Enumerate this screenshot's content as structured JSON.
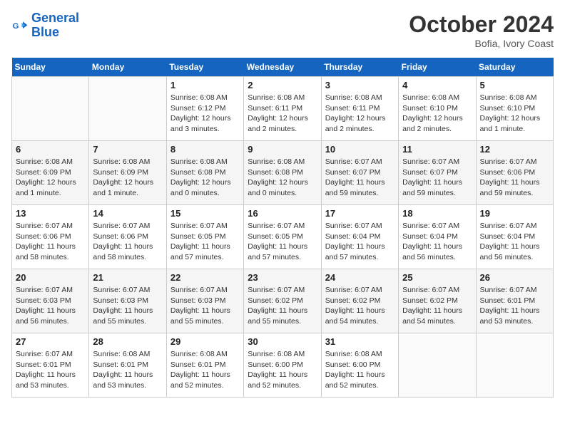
{
  "logo": {
    "line1": "General",
    "line2": "Blue"
  },
  "title": "October 2024",
  "subtitle": "Bofia, Ivory Coast",
  "header": {
    "days": [
      "Sunday",
      "Monday",
      "Tuesday",
      "Wednesday",
      "Thursday",
      "Friday",
      "Saturday"
    ]
  },
  "weeks": [
    [
      {
        "day": "",
        "info": ""
      },
      {
        "day": "",
        "info": ""
      },
      {
        "day": "1",
        "info": "Sunrise: 6:08 AM\nSunset: 6:12 PM\nDaylight: 12 hours and 3 minutes."
      },
      {
        "day": "2",
        "info": "Sunrise: 6:08 AM\nSunset: 6:11 PM\nDaylight: 12 hours and 2 minutes."
      },
      {
        "day": "3",
        "info": "Sunrise: 6:08 AM\nSunset: 6:11 PM\nDaylight: 12 hours and 2 minutes."
      },
      {
        "day": "4",
        "info": "Sunrise: 6:08 AM\nSunset: 6:10 PM\nDaylight: 12 hours and 2 minutes."
      },
      {
        "day": "5",
        "info": "Sunrise: 6:08 AM\nSunset: 6:10 PM\nDaylight: 12 hours and 1 minute."
      }
    ],
    [
      {
        "day": "6",
        "info": "Sunrise: 6:08 AM\nSunset: 6:09 PM\nDaylight: 12 hours and 1 minute."
      },
      {
        "day": "7",
        "info": "Sunrise: 6:08 AM\nSunset: 6:09 PM\nDaylight: 12 hours and 1 minute."
      },
      {
        "day": "8",
        "info": "Sunrise: 6:08 AM\nSunset: 6:08 PM\nDaylight: 12 hours and 0 minutes."
      },
      {
        "day": "9",
        "info": "Sunrise: 6:08 AM\nSunset: 6:08 PM\nDaylight: 12 hours and 0 minutes."
      },
      {
        "day": "10",
        "info": "Sunrise: 6:07 AM\nSunset: 6:07 PM\nDaylight: 11 hours and 59 minutes."
      },
      {
        "day": "11",
        "info": "Sunrise: 6:07 AM\nSunset: 6:07 PM\nDaylight: 11 hours and 59 minutes."
      },
      {
        "day": "12",
        "info": "Sunrise: 6:07 AM\nSunset: 6:06 PM\nDaylight: 11 hours and 59 minutes."
      }
    ],
    [
      {
        "day": "13",
        "info": "Sunrise: 6:07 AM\nSunset: 6:06 PM\nDaylight: 11 hours and 58 minutes."
      },
      {
        "day": "14",
        "info": "Sunrise: 6:07 AM\nSunset: 6:06 PM\nDaylight: 11 hours and 58 minutes."
      },
      {
        "day": "15",
        "info": "Sunrise: 6:07 AM\nSunset: 6:05 PM\nDaylight: 11 hours and 57 minutes."
      },
      {
        "day": "16",
        "info": "Sunrise: 6:07 AM\nSunset: 6:05 PM\nDaylight: 11 hours and 57 minutes."
      },
      {
        "day": "17",
        "info": "Sunrise: 6:07 AM\nSunset: 6:04 PM\nDaylight: 11 hours and 57 minutes."
      },
      {
        "day": "18",
        "info": "Sunrise: 6:07 AM\nSunset: 6:04 PM\nDaylight: 11 hours and 56 minutes."
      },
      {
        "day": "19",
        "info": "Sunrise: 6:07 AM\nSunset: 6:04 PM\nDaylight: 11 hours and 56 minutes."
      }
    ],
    [
      {
        "day": "20",
        "info": "Sunrise: 6:07 AM\nSunset: 6:03 PM\nDaylight: 11 hours and 56 minutes."
      },
      {
        "day": "21",
        "info": "Sunrise: 6:07 AM\nSunset: 6:03 PM\nDaylight: 11 hours and 55 minutes."
      },
      {
        "day": "22",
        "info": "Sunrise: 6:07 AM\nSunset: 6:03 PM\nDaylight: 11 hours and 55 minutes."
      },
      {
        "day": "23",
        "info": "Sunrise: 6:07 AM\nSunset: 6:02 PM\nDaylight: 11 hours and 55 minutes."
      },
      {
        "day": "24",
        "info": "Sunrise: 6:07 AM\nSunset: 6:02 PM\nDaylight: 11 hours and 54 minutes."
      },
      {
        "day": "25",
        "info": "Sunrise: 6:07 AM\nSunset: 6:02 PM\nDaylight: 11 hours and 54 minutes."
      },
      {
        "day": "26",
        "info": "Sunrise: 6:07 AM\nSunset: 6:01 PM\nDaylight: 11 hours and 53 minutes."
      }
    ],
    [
      {
        "day": "27",
        "info": "Sunrise: 6:07 AM\nSunset: 6:01 PM\nDaylight: 11 hours and 53 minutes."
      },
      {
        "day": "28",
        "info": "Sunrise: 6:08 AM\nSunset: 6:01 PM\nDaylight: 11 hours and 53 minutes."
      },
      {
        "day": "29",
        "info": "Sunrise: 6:08 AM\nSunset: 6:01 PM\nDaylight: 11 hours and 52 minutes."
      },
      {
        "day": "30",
        "info": "Sunrise: 6:08 AM\nSunset: 6:00 PM\nDaylight: 11 hours and 52 minutes."
      },
      {
        "day": "31",
        "info": "Sunrise: 6:08 AM\nSunset: 6:00 PM\nDaylight: 11 hours and 52 minutes."
      },
      {
        "day": "",
        "info": ""
      },
      {
        "day": "",
        "info": ""
      }
    ]
  ]
}
